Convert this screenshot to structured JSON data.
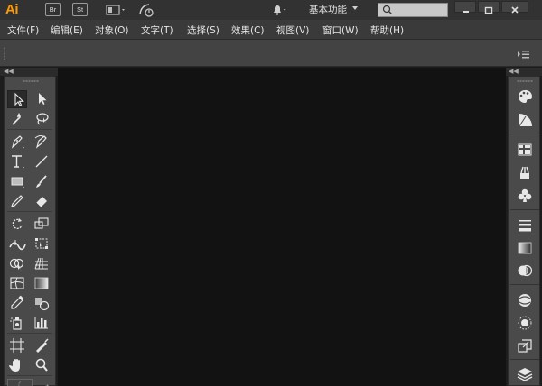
{
  "app": {
    "logo_text": "Ai",
    "bridge_label": "Br",
    "stock_label": "St"
  },
  "titlebar": {
    "workspace_label": "基本功能",
    "search_placeholder": ""
  },
  "menu": [
    {
      "label": "文件(F)"
    },
    {
      "label": "编辑(E)"
    },
    {
      "label": "对象(O)"
    },
    {
      "label": "文字(T)"
    },
    {
      "label": "选择(S)"
    },
    {
      "label": "效果(C)"
    },
    {
      "label": "视图(V)"
    },
    {
      "label": "窗口(W)"
    },
    {
      "label": "帮助(H)"
    }
  ],
  "tools": [
    [
      "selection-tool",
      "direct-selection-tool"
    ],
    [
      "magic-wand-tool",
      "lasso-tool"
    ],
    [
      "pen-tool",
      "curvature-tool"
    ],
    [
      "type-tool",
      "line-segment-tool"
    ],
    [
      "rectangle-tool",
      "paintbrush-tool"
    ],
    [
      "pencil-tool",
      "eraser-tool"
    ],
    [
      "rotate-tool",
      "scale-tool"
    ],
    [
      "width-tool",
      "free-transform-tool"
    ],
    [
      "shape-builder-tool",
      "perspective-grid-tool"
    ],
    [
      "mesh-tool",
      "gradient-tool"
    ],
    [
      "eyedropper-tool",
      "blend-tool"
    ],
    [
      "symbol-sprayer-tool",
      "column-graph-tool"
    ],
    [
      "artboard-tool",
      "slice-tool"
    ],
    [
      "hand-tool",
      "zoom-tool"
    ]
  ],
  "dock_panels": [
    "color-panel",
    "color-guide-panel",
    "swatches-panel",
    "brushes-panel",
    "symbols-panel",
    "stroke-panel",
    "gradient-panel",
    "transparency-panel",
    "appearance-panel",
    "graphic-styles-panel",
    "asset-export-panel",
    "layers-panel"
  ],
  "colors": {
    "accent": "#ff9a00",
    "canvas": "#121212",
    "panel": "#4a4a4a"
  }
}
